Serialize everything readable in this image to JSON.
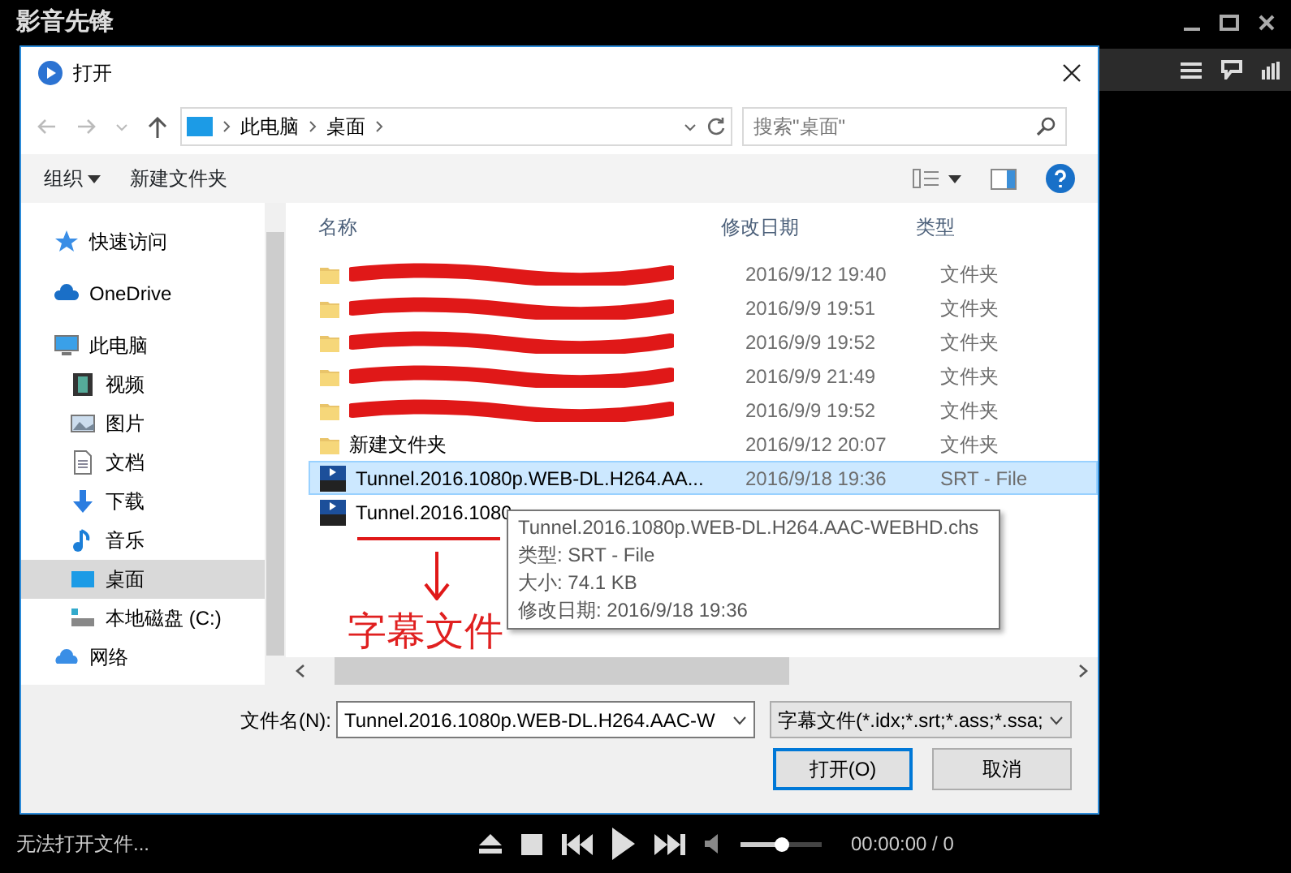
{
  "player": {
    "title": "影音先锋",
    "status": "无法打开文件...",
    "time": "00:00:00 / 0",
    "volume": {
      "level": 0.5
    }
  },
  "dialog": {
    "title": "打开",
    "address": {
      "crumbs": [
        "此电脑",
        "桌面"
      ],
      "search_placeholder": "搜索\"桌面\""
    },
    "toolbar": {
      "organize": "组织",
      "new_folder": "新建文件夹"
    },
    "nav": [
      {
        "label": "快速访问",
        "kind": "star",
        "selected": false
      },
      {
        "label": "OneDrive",
        "kind": "cloud",
        "selected": false
      },
      {
        "label": "此电脑",
        "kind": "monitor",
        "selected": false,
        "children": [
          {
            "label": "视频",
            "kind": "film",
            "selected": false
          },
          {
            "label": "图片",
            "kind": "picture",
            "selected": false
          },
          {
            "label": "文档",
            "kind": "document",
            "selected": false
          },
          {
            "label": "下载",
            "kind": "download",
            "selected": false
          },
          {
            "label": "音乐",
            "kind": "music",
            "selected": false
          },
          {
            "label": "桌面",
            "kind": "desktop",
            "selected": true
          },
          {
            "label": "本地磁盘 (C:)",
            "kind": "drive",
            "selected": false
          }
        ]
      },
      {
        "label": "网络",
        "kind": "network",
        "selected": false
      }
    ],
    "columns": [
      "名称",
      "修改日期",
      "类型"
    ],
    "rows": [
      {
        "kind": "folder",
        "date": "2016/9/12 19:40",
        "type": "文件夹",
        "selected": false,
        "redacted": true
      },
      {
        "kind": "folder",
        "date": "2016/9/9 19:51",
        "type": "文件夹",
        "selected": false,
        "redacted": true
      },
      {
        "kind": "folder",
        "date": "2016/9/9 19:52",
        "type": "文件夹",
        "selected": false,
        "redacted": true
      },
      {
        "kind": "folder",
        "date": "2016/9/9 21:49",
        "type": "文件夹",
        "selected": false,
        "redacted": true
      },
      {
        "kind": "folder",
        "date": "2016/9/9 19:52",
        "type": "文件夹",
        "selected": false,
        "redacted": true
      },
      {
        "kind": "folder",
        "name": "新建文件夹",
        "date": "2016/9/12 20:07",
        "type": "文件夹",
        "selected": false,
        "redacted": false
      },
      {
        "kind": "srt",
        "name": "Tunnel.2016.1080p.WEB-DL.H264.AA...",
        "date": "2016/9/18 19:36",
        "type": "SRT - File",
        "selected": true,
        "redacted": false
      },
      {
        "kind": "srt",
        "name": "Tunnel.2016.1080",
        "selected": false,
        "redacted": false
      }
    ],
    "tooltip": [
      "Tunnel.2016.1080p.WEB-DL.H264.AAC-WEBHD.chs",
      "类型: SRT - File",
      "大小: 74.1 KB",
      "修改日期: 2016/9/18 19:36"
    ],
    "annotation": "字幕文件",
    "filename_label": "文件名(N):",
    "filename": "Tunnel.2016.1080p.WEB-DL.H264.AAC-W",
    "filter": "字幕文件(*.idx;*.srt;*.ass;*.ssa;",
    "buttons": [
      "打开(O)",
      "取消"
    ]
  }
}
